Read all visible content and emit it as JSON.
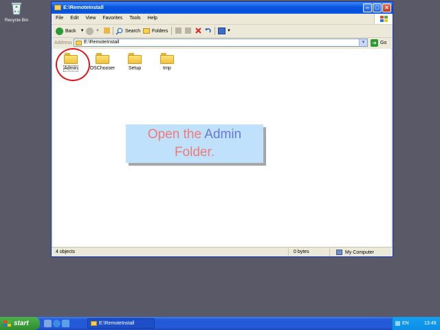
{
  "desktop": {
    "recycle_label": "Recycle Bin"
  },
  "window": {
    "title": "E:\\RemoteInstall",
    "menu": [
      "File",
      "Edit",
      "View",
      "Favorites",
      "Tools",
      "Help"
    ],
    "toolbar": {
      "back": "Back",
      "search": "Search",
      "folders": "Folders"
    },
    "address": {
      "label": "Address",
      "value": "E:\\RemoteInstall",
      "go": "Go"
    },
    "folders": [
      {
        "name": "Admin",
        "selected": true
      },
      {
        "name": "OSChooser",
        "selected": false
      },
      {
        "name": "Setup",
        "selected": false
      },
      {
        "name": "tmp",
        "selected": false
      }
    ],
    "status": {
      "objects": "4 objects",
      "size": "0 bytes",
      "location": "My Computer"
    }
  },
  "callout": {
    "pre": "Open the ",
    "highlight": "Admin",
    "post": "Folder."
  },
  "taskbar": {
    "start": "start",
    "task_window": "E:\\RemoteInstall",
    "language": "EN",
    "clock": "13:49"
  },
  "colors": {
    "callout_bg": "#bfe1fb",
    "callout_text": "#ef7a79",
    "callout_highlight": "#6677d4",
    "circle": "#e0131b"
  }
}
